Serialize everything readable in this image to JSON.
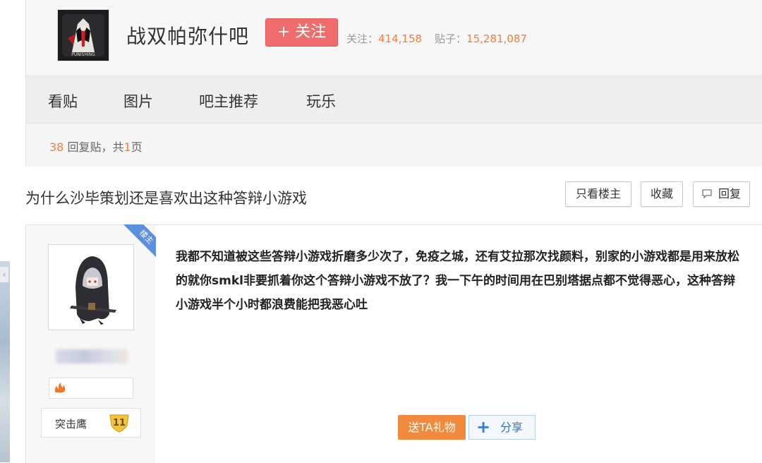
{
  "forum": {
    "name": "战双帕弥什吧",
    "follow_label": "+ 关注",
    "followers_label": "关注：",
    "followers_value": "414,158",
    "posts_label": "贴子：",
    "posts_value": "15,281,087"
  },
  "nav": {
    "items": [
      {
        "label": "看贴"
      },
      {
        "label": "图片"
      },
      {
        "label": "吧主推荐"
      },
      {
        "label": "玩乐"
      }
    ]
  },
  "thread_info": {
    "reply_count": "38",
    "reply_text": " 回复贴，共",
    "page_count": "1",
    "page_suffix": "页"
  },
  "thread": {
    "title": "为什么沙毕策划还是喜欢出这种答辩小游戏",
    "only_op_label": "只看楼主",
    "favorite_label": "收藏",
    "reply_label": "回复"
  },
  "post": {
    "op_badge": "楼主",
    "level_name": "突击鹰",
    "level_number": "11",
    "content": "我都不知道被这些答辩小游戏折磨多少次了，免疫之城，还有艾拉那次找颜料，别家的小游戏都是用来放松的就你smkl非要抓着你这个答辩小游戏不放了？我一下午的时间用在巴别塔据点都不觉得恶心，这种答辩小游戏半个小时都浪费能把我恶心吐",
    "gift_label": "送TA礼物",
    "share_label": "分享"
  },
  "logo_text": "PUNISHING",
  "colors": {
    "accent_orange": "#f27d3d",
    "follow_red": "#f16c6c",
    "op_blue": "#5b8fe0",
    "share_blue": "#3072c4"
  },
  "icons": [
    "forum-logo-icon",
    "reply-icon",
    "flame-icon",
    "level-shield-icon",
    "plus-icon",
    "arrow-left-icon"
  ]
}
